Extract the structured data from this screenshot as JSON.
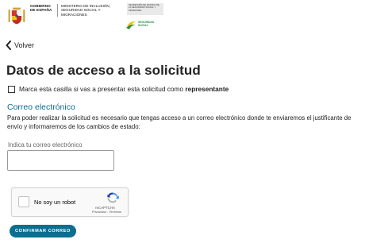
{
  "header": {
    "gov_line1": "GOBIERNO DE ESPAÑA",
    "gov_line2": "MINISTERIO DE INCLUSIÓN, SEGURIDAD SOCIAL Y MIGRACIONES",
    "secretaria": "SECRETARÍA DE ESTADO DE LA SEGURIDAD SOCIAL Y PENSIONES",
    "ss_name": "SEGURIDAD SOCIAL"
  },
  "nav": {
    "back_label": "Volver"
  },
  "page": {
    "title": "Datos de acceso a la solicitud"
  },
  "representative": {
    "label_prefix": "Marca esta casilla si vas a presentar esta solicitud como ",
    "label_bold": "representante",
    "checked": false
  },
  "email_section": {
    "title": "Correo electrónico",
    "description": "Para poder realizar la solicitud es necesario que tengas acceso a un correo electrónico donde te enviaremos el justificante de envío y informaremos de los cambios de estado:",
    "input_label": "Indica tu correo electrónico",
    "input_value": ""
  },
  "recaptcha": {
    "label": "No soy un robot",
    "brand": "reCAPTCHA",
    "links": "Privacidad - Términos"
  },
  "actions": {
    "confirm_label": "CONFIRMAR CORREO"
  },
  "colors": {
    "accent": "#0b6b8c",
    "button": "#0c6e90",
    "ss_green": "#2e8a49"
  }
}
